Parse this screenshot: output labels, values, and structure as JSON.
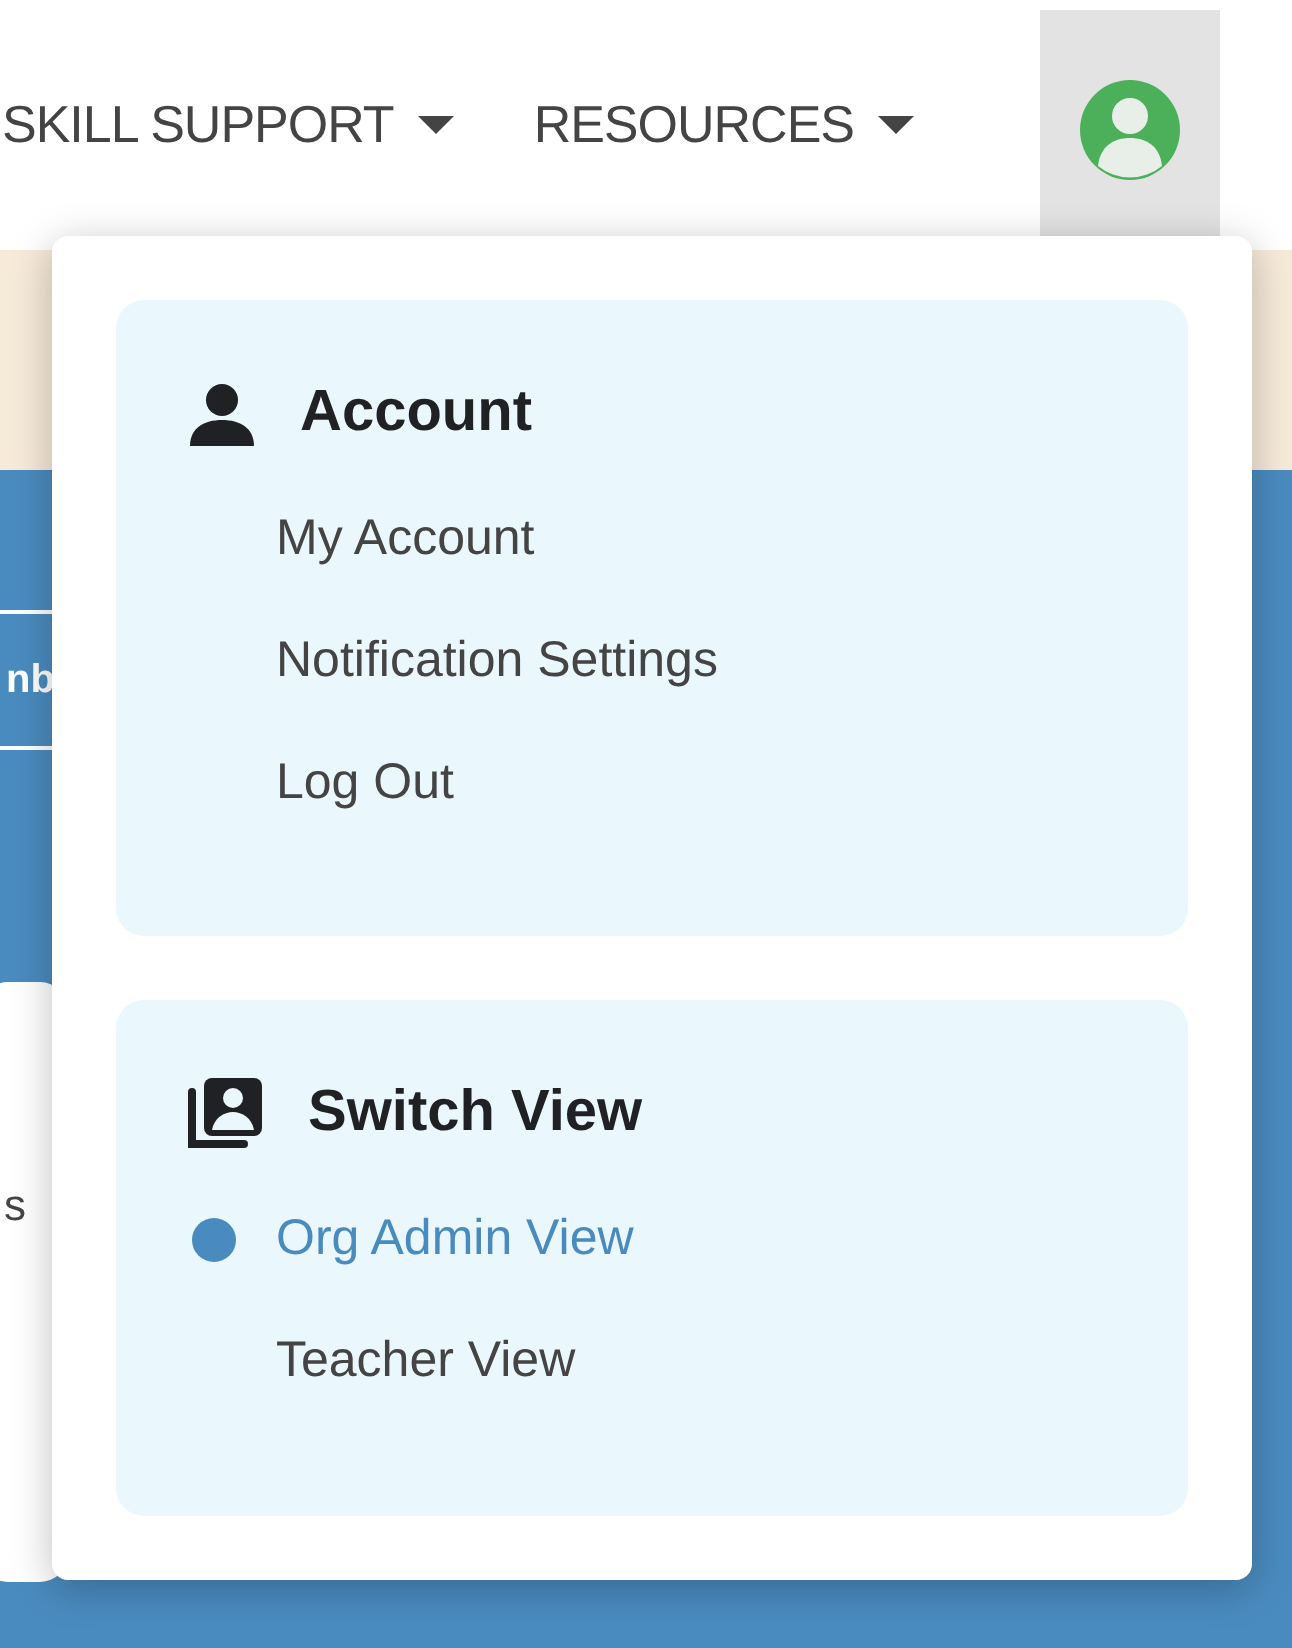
{
  "nav": {
    "items": [
      {
        "label": "SKILL SUPPORT"
      },
      {
        "label": "RESOURCES"
      }
    ],
    "account_button": {
      "expanded": true
    }
  },
  "background": {
    "button_text": "nb",
    "card_text": "s"
  },
  "menu": {
    "sections": [
      {
        "kind": "account",
        "title": "Account",
        "items": [
          {
            "label": "My Account",
            "selected": false
          },
          {
            "label": "Notification Settings",
            "selected": false
          },
          {
            "label": "Log Out",
            "selected": false
          }
        ]
      },
      {
        "kind": "views",
        "title": "Switch View",
        "items": [
          {
            "label": "Org Admin View",
            "selected": true
          },
          {
            "label": "Teacher View",
            "selected": false
          }
        ]
      }
    ]
  }
}
